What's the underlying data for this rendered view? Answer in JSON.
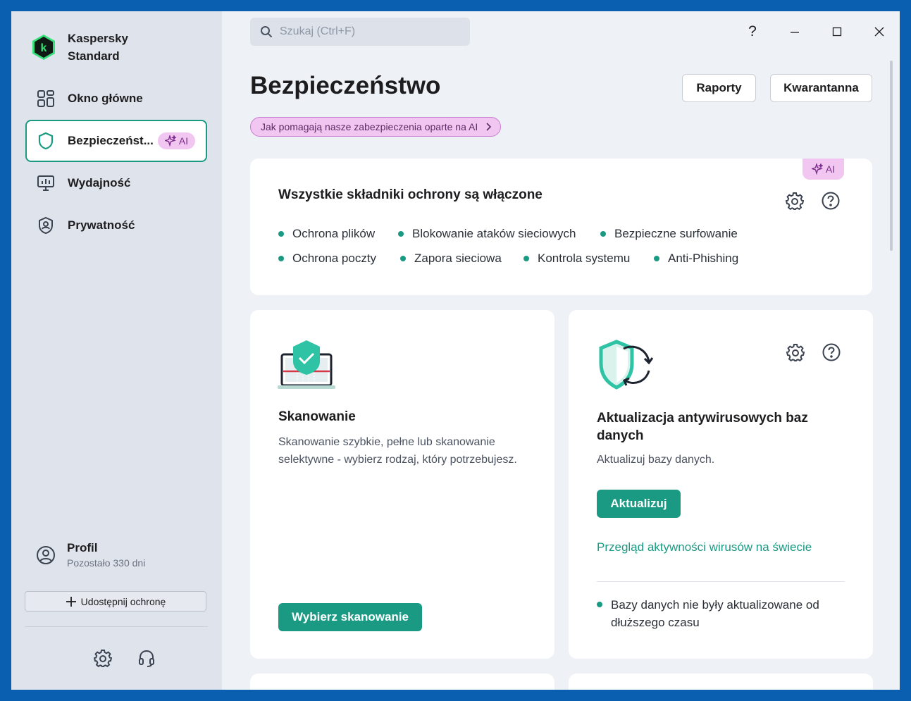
{
  "app": {
    "name_line1": "Kaspersky",
    "name_line2": "Standard",
    "brand_color": "#1a9a82",
    "accent_ai": "#f1c6f0"
  },
  "sidebar": {
    "items": [
      {
        "label": "Okno główne",
        "icon": "dashboard-icon"
      },
      {
        "label": "Bezpieczeńst...",
        "icon": "shield-icon",
        "badge": "AI",
        "active": true
      },
      {
        "label": "Wydajność",
        "icon": "monitor-performance-icon"
      },
      {
        "label": "Prywatność",
        "icon": "privacy-shield-icon"
      }
    ],
    "profile": {
      "name": "Profil",
      "subtitle": "Pozostało 330 dni"
    },
    "share_button": "Udostępnij ochronę"
  },
  "search": {
    "placeholder": "Szukaj (Ctrl+F)"
  },
  "window_controls": {
    "help": "?"
  },
  "header": {
    "title": "Bezpieczeństwo",
    "reports_button": "Raporty",
    "quarantine_button": "Kwarantanna",
    "ai_banner": "Jak pomagają nasze zabezpieczenia oparte na AI"
  },
  "status_card": {
    "ai_tag": "AI",
    "title": "Wszystkie składniki ochrony są włączone",
    "components": [
      "Ochrona plików",
      "Blokowanie ataków sieciowych",
      "Bezpieczne surfowanie",
      "Ochrona poczty",
      "Zapora sieciowa",
      "Kontrola systemu",
      "Anti-Phishing"
    ]
  },
  "scan_card": {
    "title": "Skanowanie",
    "description": "Skanowanie szybkie, pełne lub skanowanie selektywne - wybierz rodzaj, który potrzebujesz.",
    "button": "Wybierz skanowanie"
  },
  "update_card": {
    "title": "Aktualizacja antywirusowych baz danych",
    "description": "Aktualizuj bazy danych.",
    "button": "Aktualizuj",
    "link": "Przegląd aktywności wirusów na świecie",
    "status": "Bazy danych nie były aktualizowane od dłuższego czasu"
  }
}
